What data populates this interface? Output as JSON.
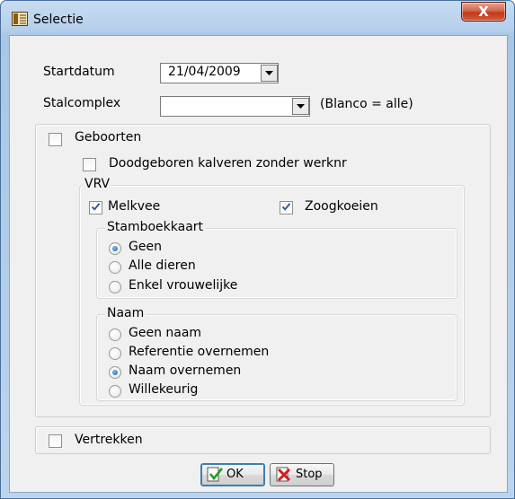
{
  "window": {
    "title": "Selectie",
    "close_label": "X"
  },
  "form": {
    "startdatum_label": "Startdatum",
    "startdatum_value": "21/04/2009",
    "stalcomplex_label": "Stalcomplex",
    "stalcomplex_value": "",
    "stalcomplex_hint": "(Blanco = alle)"
  },
  "geboorten": {
    "label": "Geboorten",
    "checked": false,
    "doodgeboren_label": "Doodgeboren kalveren zonder werknr",
    "doodgeboren_checked": false
  },
  "vrv": {
    "legend": "VRV",
    "melkvee_label": "Melkvee",
    "melkvee_checked": true,
    "zoogkoeien_label": "Zoogkoeien",
    "zoogkoeien_checked": true,
    "stamboekkaart": {
      "legend": "Stamboekkaart",
      "options": [
        "Geen",
        "Alle dieren",
        "Enkel vrouwelijke"
      ],
      "selected": "Geen"
    },
    "naam": {
      "legend": "Naam",
      "options": [
        "Geen naam",
        "Referentie overnemen",
        "Naam overnemen",
        "Willekeurig"
      ],
      "selected": "Naam overnemen"
    }
  },
  "vertrekken": {
    "label": "Vertrekken",
    "checked": false
  },
  "buttons": {
    "ok_label": "OK",
    "stop_label": "Stop"
  },
  "icons": {
    "app": "document-grid-icon",
    "ok": "checkmark-document-icon",
    "stop": "red-x-icon"
  }
}
